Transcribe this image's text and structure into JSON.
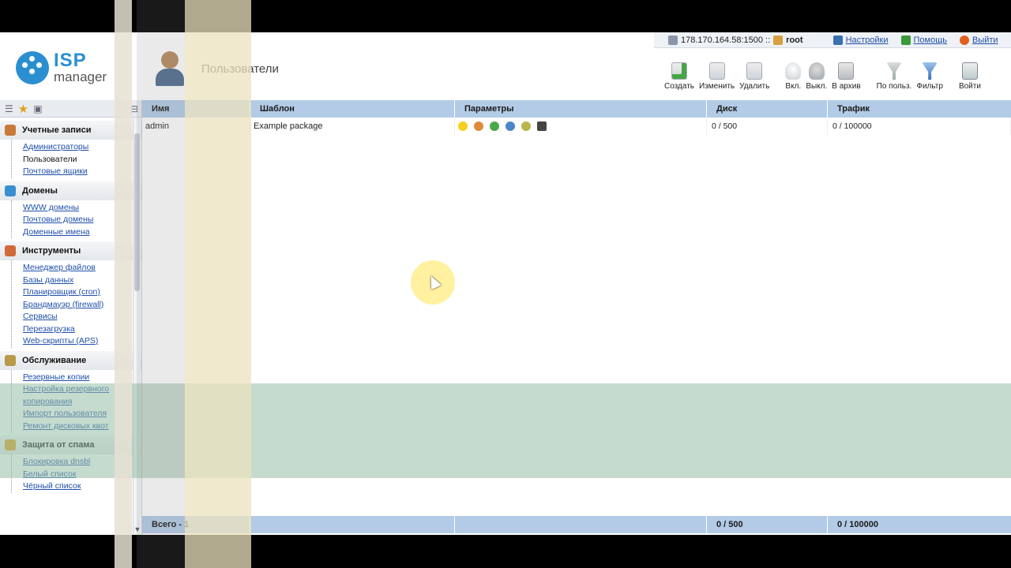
{
  "topbar": {
    "server": "178.170.164.58:1500 ::",
    "user": "root",
    "settings": "Настройки",
    "help": "Помощь",
    "logout": "Выйти"
  },
  "logo": {
    "isp": "ISP",
    "manager": "manager"
  },
  "page": {
    "title": "Пользователи"
  },
  "toolbar": {
    "create": "Создать",
    "edit": "Изменить",
    "delete": "Удалить",
    "enable": "Вкл.",
    "disable": "Выкл.",
    "archive": "В архив",
    "by_user": "По польз.",
    "filter": "Фильтр",
    "login": "Войти"
  },
  "sidebar": {
    "sections": [
      {
        "title": "Учетные записи",
        "color": "#c97a3a",
        "links": [
          "Администраторы",
          "Пользователи",
          "Почтовые ящики"
        ]
      },
      {
        "title": "Домены",
        "color": "#3a8fd0",
        "links": [
          "WWW домены",
          "Почтовые домены",
          "Доменные имена"
        ]
      },
      {
        "title": "Инструменты",
        "color": "#d06a3a",
        "links": [
          "Менеджер файлов",
          "Базы данных",
          "Планировщик (cron)",
          "Брандмауэр (firewall)",
          "Сервисы",
          "Перезагрузка",
          "Web-скрипты (APS)"
        ]
      },
      {
        "title": "Обслуживание",
        "color": "#b89a4a",
        "links": [
          "Резервные копии",
          "Настройка резервного копирования",
          "Импорт пользователя",
          "Ремонт дисковых квот"
        ]
      },
      {
        "title": "Защита от спама",
        "color": "#e0a020",
        "links": [
          "Блокировка dnsbl",
          "Белый список",
          "Чёрный список"
        ]
      }
    ]
  },
  "table": {
    "headers": [
      "Имя",
      "Шаблон",
      "Параметры",
      "Диск",
      "Трафик"
    ],
    "rows": [
      {
        "name": "admin",
        "template": "Example package",
        "disk": "0 / 500",
        "traffic": "0 / 100000"
      }
    ],
    "param_icons": [
      "bulb-icon",
      "ssi-icon",
      "php-icon",
      "cgi-icon",
      "ssl-icon",
      "shell-icon"
    ],
    "footer": {
      "total": "Всего - 1",
      "disk": "0 / 500",
      "traffic": "0 / 100000"
    }
  }
}
